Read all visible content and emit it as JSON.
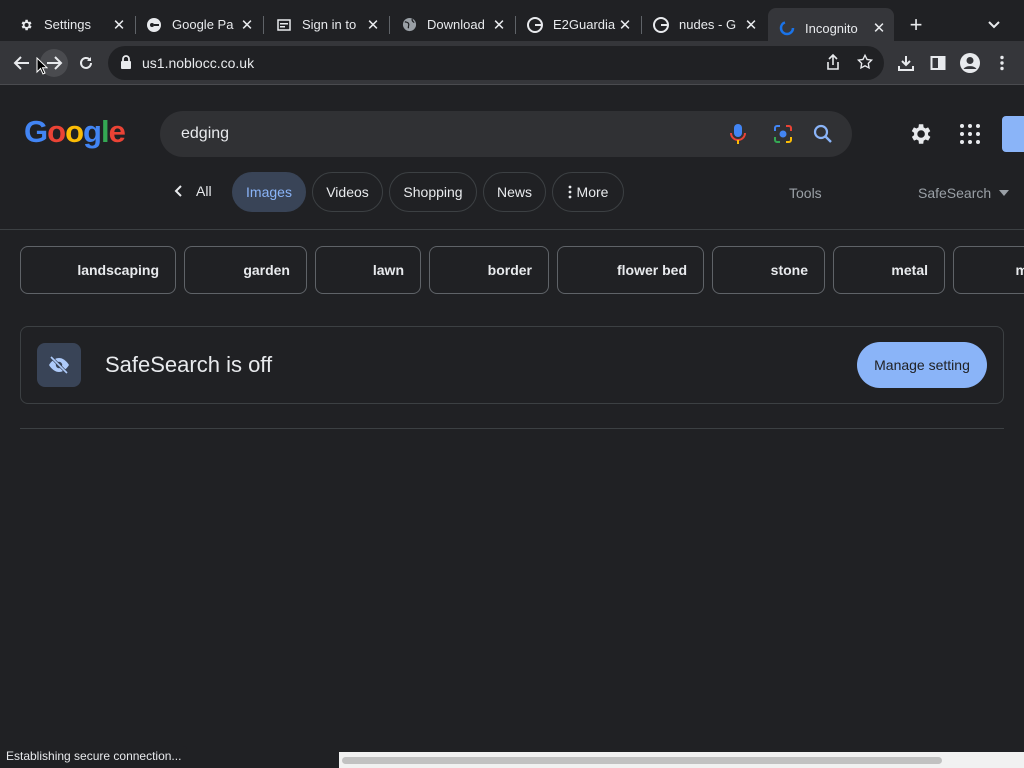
{
  "browser": {
    "tabs": [
      {
        "title": "Settings",
        "icon": "gear-icon"
      },
      {
        "title": "Google Pa",
        "icon": "key-icon"
      },
      {
        "title": "Sign in to",
        "icon": "site-icon"
      },
      {
        "title": "Download",
        "icon": "globe-icon"
      },
      {
        "title": "E2Guardia",
        "icon": "google-icon"
      },
      {
        "title": "nudes - G",
        "icon": "google-icon"
      },
      {
        "title": "Incognito",
        "icon": "loading-icon"
      }
    ],
    "url": "us1.noblocc.co.uk"
  },
  "search": {
    "query": "edging",
    "logo_letters": [
      "G",
      "o",
      "o",
      "g",
      "l",
      "e"
    ],
    "logo_colors": [
      "#4285f4",
      "#ea4335",
      "#fbbc05",
      "#4285f4",
      "#34a853",
      "#ea4335"
    ]
  },
  "nav": {
    "all_label": "All",
    "tabs": [
      "Images",
      "Videos",
      "Shopping",
      "News",
      "More"
    ],
    "tools_label": "Tools",
    "safesearch_label": "SafeSearch"
  },
  "refinements": [
    "landscaping",
    "garden",
    "lawn",
    "border",
    "flower bed",
    "stone",
    "metal",
    "m"
  ],
  "safesearch_card": {
    "message": "SafeSearch is off",
    "button_label": "Manage setting"
  },
  "status_text": "Establishing secure connection...",
  "colors": {
    "accent": "#8ab4f8",
    "background": "#202124",
    "toolbar": "#35363a"
  }
}
